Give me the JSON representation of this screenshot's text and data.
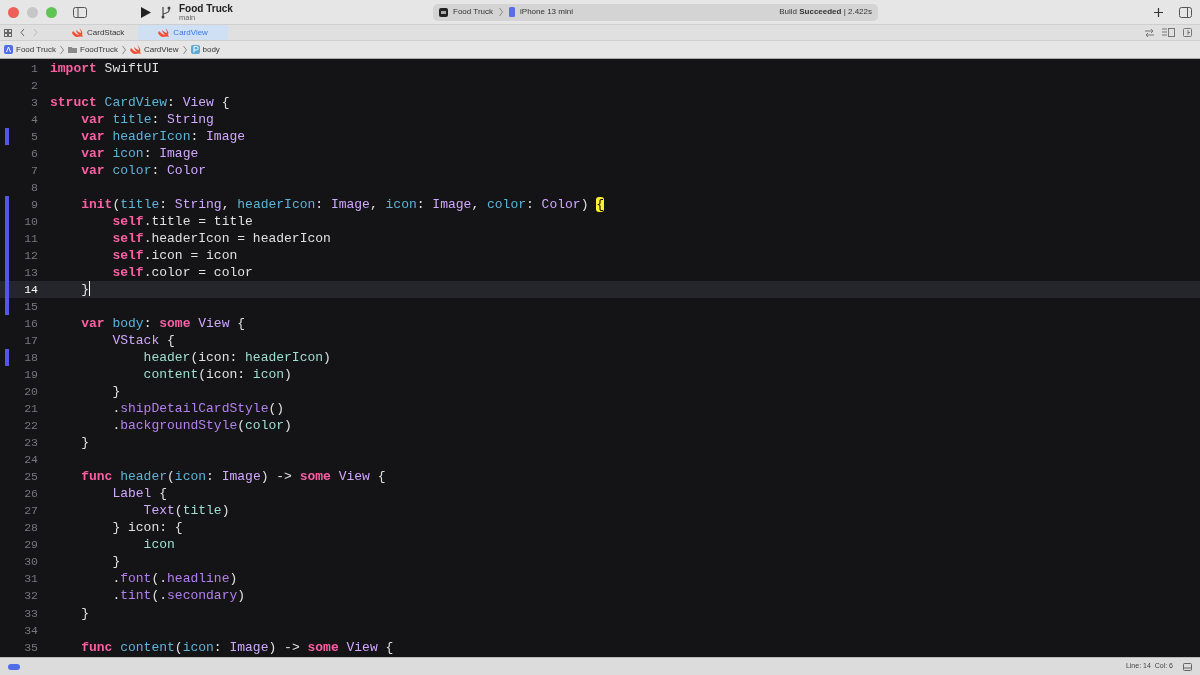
{
  "window": {
    "project": "Food Truck",
    "branch": "main",
    "scheme": {
      "target": "Food Truck",
      "device": "iPhone 13 mini"
    },
    "build_status": "Build **Succeeded** | 2.422s"
  },
  "tabs": [
    {
      "label": "CardStack",
      "selected": false
    },
    {
      "label": "CardView",
      "selected": true
    }
  ],
  "breadcrumb": [
    {
      "label": "Food Truck",
      "kind": "project"
    },
    {
      "label": "FoodTruck",
      "kind": "folder"
    },
    {
      "label": "CardView",
      "kind": "swift"
    },
    {
      "label": "body",
      "kind": "property"
    }
  ],
  "editor": {
    "lines": [
      {
        "number": "1",
        "changed": false,
        "current": false,
        "tokens": [
          {
            "kind": "kw",
            "text": "import "
          },
          {
            "kind": "pl",
            "text": "SwiftUI"
          }
        ]
      },
      {
        "number": "2",
        "changed": false,
        "current": false
      },
      {
        "number": "3",
        "changed": false,
        "current": false,
        "tokens": [
          {
            "kind": "kw",
            "text": "struct "
          },
          {
            "kind": "decl",
            "text": "CardView"
          },
          {
            "kind": "pl",
            "text": ": "
          },
          {
            "kind": "typ",
            "text": "View"
          },
          {
            "kind": "pl",
            "text": " {"
          }
        ]
      },
      {
        "number": "4",
        "changed": false,
        "current": false,
        "tokens": [
          {
            "kind": "kw",
            "text": "    var "
          },
          {
            "kind": "decl",
            "text": "title"
          },
          {
            "kind": "pl",
            "text": ": "
          },
          {
            "kind": "typ",
            "text": "String"
          }
        ]
      },
      {
        "number": "5",
        "changed": true,
        "current": false,
        "tokens": [
          {
            "kind": "kw",
            "text": "    var "
          },
          {
            "kind": "decl",
            "text": "headerIcon"
          },
          {
            "kind": "pl",
            "text": ": "
          },
          {
            "kind": "typ",
            "text": "Image"
          }
        ]
      },
      {
        "number": "6",
        "changed": false,
        "current": false,
        "tokens": [
          {
            "kind": "kw",
            "text": "    var "
          },
          {
            "kind": "decl",
            "text": "icon"
          },
          {
            "kind": "pl",
            "text": ": "
          },
          {
            "kind": "typ",
            "text": "Image"
          }
        ]
      },
      {
        "number": "7",
        "changed": false,
        "current": false,
        "tokens": [
          {
            "kind": "kw",
            "text": "    var "
          },
          {
            "kind": "decl",
            "text": "color"
          },
          {
            "kind": "pl",
            "text": ": "
          },
          {
            "kind": "typ",
            "text": "Color"
          }
        ]
      },
      {
        "number": "8",
        "changed": false,
        "current": false
      },
      {
        "number": "9",
        "changed": true,
        "current": false,
        "tokens": [
          {
            "kind": "kw",
            "text": "    init"
          },
          {
            "kind": "pl",
            "text": "("
          },
          {
            "kind": "decl",
            "text": "title"
          },
          {
            "kind": "pl",
            "text": ": "
          },
          {
            "kind": "typ",
            "text": "String"
          },
          {
            "kind": "pl",
            "text": ", "
          },
          {
            "kind": "decl",
            "text": "headerIcon"
          },
          {
            "kind": "pl",
            "text": ": "
          },
          {
            "kind": "typ",
            "text": "Image"
          },
          {
            "kind": "pl",
            "text": ", "
          },
          {
            "kind": "decl",
            "text": "icon"
          },
          {
            "kind": "pl",
            "text": ": "
          },
          {
            "kind": "typ",
            "text": "Image"
          },
          {
            "kind": "pl",
            "text": ", "
          },
          {
            "kind": "decl",
            "text": "color"
          },
          {
            "kind": "pl",
            "text": ": "
          },
          {
            "kind": "typ",
            "text": "Color"
          },
          {
            "kind": "pl",
            "text": ") "
          },
          {
            "kind": "match",
            "text": "{"
          }
        ]
      },
      {
        "number": "10",
        "changed": true,
        "current": false,
        "tokens": [
          {
            "kind": "kw",
            "text": "        self"
          },
          {
            "kind": "pl",
            "text": ".title = title"
          }
        ]
      },
      {
        "number": "11",
        "changed": true,
        "current": false,
        "tokens": [
          {
            "kind": "kw",
            "text": "        self"
          },
          {
            "kind": "pl",
            "text": ".headerIcon = headerIcon"
          }
        ]
      },
      {
        "number": "12",
        "changed": true,
        "current": false,
        "tokens": [
          {
            "kind": "kw",
            "text": "        self"
          },
          {
            "kind": "pl",
            "text": ".icon = icon"
          }
        ]
      },
      {
        "number": "13",
        "changed": true,
        "current": false,
        "tokens": [
          {
            "kind": "kw",
            "text": "        self"
          },
          {
            "kind": "pl",
            "text": ".color = color"
          }
        ]
      },
      {
        "number": "14",
        "changed": true,
        "current": true,
        "tokens": [
          {
            "kind": "pl",
            "text": "    }"
          }
        ]
      },
      {
        "number": "15",
        "changed": true,
        "current": false
      },
      {
        "number": "16",
        "changed": false,
        "current": false,
        "tokens": [
          {
            "kind": "kw",
            "text": "    var "
          },
          {
            "kind": "decl",
            "text": "body"
          },
          {
            "kind": "pl",
            "text": ": "
          },
          {
            "kind": "kw",
            "text": "some "
          },
          {
            "kind": "typ",
            "text": "View"
          },
          {
            "kind": "pl",
            "text": " {"
          }
        ]
      },
      {
        "number": "17",
        "changed": false,
        "current": false,
        "tokens": [
          {
            "kind": "typ",
            "text": "        VStack"
          },
          {
            "kind": "pl",
            "text": " {"
          }
        ]
      },
      {
        "number": "18",
        "changed": true,
        "current": false,
        "tokens": [
          {
            "kind": "proj",
            "text": "            header"
          },
          {
            "kind": "pl",
            "text": "(icon: "
          },
          {
            "kind": "proj",
            "text": "headerIcon"
          },
          {
            "kind": "pl",
            "text": ")"
          }
        ]
      },
      {
        "number": "19",
        "changed": false,
        "current": false,
        "tokens": [
          {
            "kind": "proj",
            "text": "            content"
          },
          {
            "kind": "pl",
            "text": "(icon: "
          },
          {
            "kind": "proj",
            "text": "icon"
          },
          {
            "kind": "pl",
            "text": ")"
          }
        ]
      },
      {
        "number": "20",
        "changed": false,
        "current": false,
        "tokens": [
          {
            "kind": "pl",
            "text": "        }"
          }
        ]
      },
      {
        "number": "21",
        "changed": false,
        "current": false,
        "tokens": [
          {
            "kind": "pl",
            "text": "        ."
          },
          {
            "kind": "other",
            "text": "shipDetailCardStyle"
          },
          {
            "kind": "pl",
            "text": "()"
          }
        ]
      },
      {
        "number": "22",
        "changed": false,
        "current": false,
        "tokens": [
          {
            "kind": "pl",
            "text": "        ."
          },
          {
            "kind": "other",
            "text": "backgroundStyle"
          },
          {
            "kind": "pl",
            "text": "("
          },
          {
            "kind": "proj",
            "text": "color"
          },
          {
            "kind": "pl",
            "text": ")"
          }
        ]
      },
      {
        "number": "23",
        "changed": false,
        "current": false,
        "tokens": [
          {
            "kind": "pl",
            "text": "    }"
          }
        ]
      },
      {
        "number": "24",
        "changed": false,
        "current": false
      },
      {
        "number": "25",
        "changed": false,
        "current": false,
        "tokens": [
          {
            "kind": "kw",
            "text": "    func "
          },
          {
            "kind": "decl",
            "text": "header"
          },
          {
            "kind": "pl",
            "text": "("
          },
          {
            "kind": "decl",
            "text": "icon"
          },
          {
            "kind": "pl",
            "text": ": "
          },
          {
            "kind": "typ",
            "text": "Image"
          },
          {
            "kind": "pl",
            "text": ") -> "
          },
          {
            "kind": "kw",
            "text": "some "
          },
          {
            "kind": "typ",
            "text": "View"
          },
          {
            "kind": "pl",
            "text": " {"
          }
        ]
      },
      {
        "number": "26",
        "changed": false,
        "current": false,
        "tokens": [
          {
            "kind": "typ",
            "text": "        Label"
          },
          {
            "kind": "pl",
            "text": " {"
          }
        ]
      },
      {
        "number": "27",
        "changed": false,
        "current": false,
        "tokens": [
          {
            "kind": "typ",
            "text": "            Text"
          },
          {
            "kind": "pl",
            "text": "("
          },
          {
            "kind": "proj",
            "text": "title"
          },
          {
            "kind": "pl",
            "text": ")"
          }
        ]
      },
      {
        "number": "28",
        "changed": false,
        "current": false,
        "tokens": [
          {
            "kind": "pl",
            "text": "        } icon: {"
          }
        ]
      },
      {
        "number": "29",
        "changed": false,
        "current": false,
        "tokens": [
          {
            "kind": "proj",
            "text": "            icon"
          }
        ]
      },
      {
        "number": "30",
        "changed": false,
        "current": false,
        "tokens": [
          {
            "kind": "pl",
            "text": "        }"
          }
        ]
      },
      {
        "number": "31",
        "changed": false,
        "current": false,
        "tokens": [
          {
            "kind": "pl",
            "text": "        ."
          },
          {
            "kind": "other",
            "text": "font"
          },
          {
            "kind": "pl",
            "text": "(."
          },
          {
            "kind": "other",
            "text": "headline"
          },
          {
            "kind": "pl",
            "text": ")"
          }
        ]
      },
      {
        "number": "32",
        "changed": false,
        "current": false,
        "tokens": [
          {
            "kind": "pl",
            "text": "        ."
          },
          {
            "kind": "other",
            "text": "tint"
          },
          {
            "kind": "pl",
            "text": "(."
          },
          {
            "kind": "other",
            "text": "secondary"
          },
          {
            "kind": "pl",
            "text": ")"
          }
        ]
      },
      {
        "number": "33",
        "changed": false,
        "current": false,
        "tokens": [
          {
            "kind": "pl",
            "text": "    }"
          }
        ]
      },
      {
        "number": "34",
        "changed": false,
        "current": false
      },
      {
        "number": "35",
        "changed": false,
        "current": false,
        "tokens": [
          {
            "kind": "kw",
            "text": "    func "
          },
          {
            "kind": "decl",
            "text": "content"
          },
          {
            "kind": "pl",
            "text": "("
          },
          {
            "kind": "decl",
            "text": "icon"
          },
          {
            "kind": "pl",
            "text": ": "
          },
          {
            "kind": "typ",
            "text": "Image"
          },
          {
            "kind": "pl",
            "text": ") -> "
          },
          {
            "kind": "kw",
            "text": "some "
          },
          {
            "kind": "typ",
            "text": "View"
          },
          {
            "kind": "pl",
            "text": " {"
          }
        ]
      }
    ]
  },
  "status_bar": {
    "position": "Line: 14  Col: 6"
  }
}
